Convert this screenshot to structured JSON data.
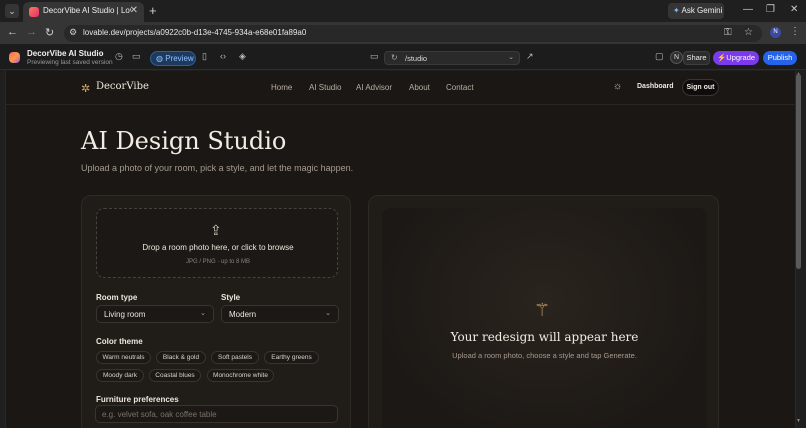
{
  "browser": {
    "tab_title": "DecorVibe AI Studio | Lovable",
    "ask_gemini": "Ask Gemini",
    "url": "lovable.dev/projects/a0922c0b-d13e-4745-934a-e68e01fa89a0",
    "profile_initial": "N"
  },
  "lovable": {
    "project_name": "DecorVibe AI Studio",
    "status": "Previewing last saved version",
    "preview_label": "Preview",
    "route": "/studio",
    "user_initial": "N",
    "share_label": "Share",
    "upgrade_label": "Upgrade",
    "publish_label": "Publish"
  },
  "site": {
    "brand": "DecorVibe",
    "nav": [
      "Home",
      "AI Studio",
      "AI Advisor",
      "About",
      "Contact"
    ],
    "dashboard_label": "Dashboard",
    "signout_label": "Sign out"
  },
  "hero": {
    "title": "AI Design Studio",
    "subtitle": "Upload a photo of your room, pick a style, and let the magic happen."
  },
  "form": {
    "drop_text": "Drop a room photo here, or click to browse",
    "drop_hint": "JPG / PNG · up to 8 MB",
    "room_type_label": "Room type",
    "room_type_value": "Living room",
    "style_label": "Style",
    "style_value": "Modern",
    "color_theme_label": "Color theme",
    "color_themes": [
      "Warm neutrals",
      "Black & gold",
      "Soft pastels",
      "Earthy greens",
      "Moody dark",
      "Coastal blues",
      "Monochrome white"
    ],
    "furniture_label": "Furniture preferences",
    "furniture_placeholder": "e.g. velvet sofa, oak coffee table"
  },
  "result": {
    "title": "Your redesign will appear here",
    "subtitle": "Upload a room photo, choose a style and tap Generate."
  },
  "colors": {
    "accent_gold": "#d9a66a",
    "upgrade": "#7c3aed",
    "publish": "#2563eb",
    "page_bg": "#1a1714"
  }
}
